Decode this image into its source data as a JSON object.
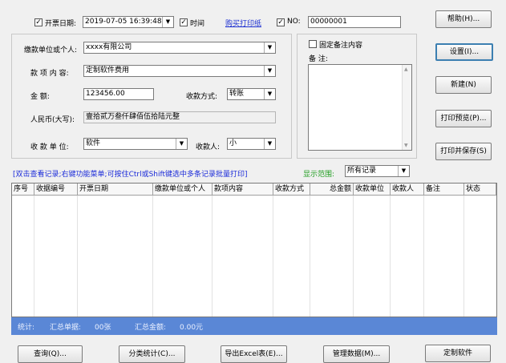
{
  "header": {
    "date_label": "开票日期:",
    "date_value": "2019-07-05 16:39:48",
    "time_label": "时间",
    "buy_paper_link": "购买打印纸",
    "no_label": "NO:",
    "no_value": "00000001"
  },
  "form": {
    "payer_label": "缴款单位或个人:",
    "payer_value": "xxxx有限公司",
    "item_label": "款 项 内 容:",
    "item_value": "定制软件费用",
    "amount_label": "金      额:",
    "amount_value": "123456.00",
    "method_label": "收款方式:",
    "method_value": "转账",
    "rmb_label": "人民币(大写):",
    "rmb_value": "壹拾贰万叁仟肆佰伍拾陆元整",
    "receiver_unit_label": "收 款 单 位:",
    "receiver_unit_value": "软件",
    "receiver_label": "收款人:",
    "receiver_value": "小"
  },
  "notes": {
    "fixed_label": "固定备注内容",
    "notes_label": "备 注:"
  },
  "buttons": {
    "help": "帮助(H)...",
    "settings": "设置(I)...",
    "new": "新建(N)",
    "print_preview": "打印预览(P)...",
    "print_save": "打印并保存(S)"
  },
  "list_hint": "[双击查看记录;右键功能菜单;可按住Ctrl或Shift键选中多条记录批量打印]",
  "range_label": "显示范围:",
  "range_value": "所有记录",
  "columns": [
    "序号",
    "收据编号",
    "开票日期",
    "缴款单位或个人",
    "款项内容",
    "收款方式",
    "总金额",
    "收款单位",
    "收款人",
    "备注",
    "状态"
  ],
  "stats": {
    "label": "统计:",
    "count_label": "汇总单据:",
    "count_value": "00张",
    "amount_label": "汇总金额:",
    "amount_value": "0.00元"
  },
  "bottom_buttons": {
    "query": "查询(Q)...",
    "category_stats": "分类统计(C)...",
    "export_excel": "导出Excel表(E)...",
    "manage_data": "管理数据(M)...",
    "custom_software": "定制软件"
  }
}
